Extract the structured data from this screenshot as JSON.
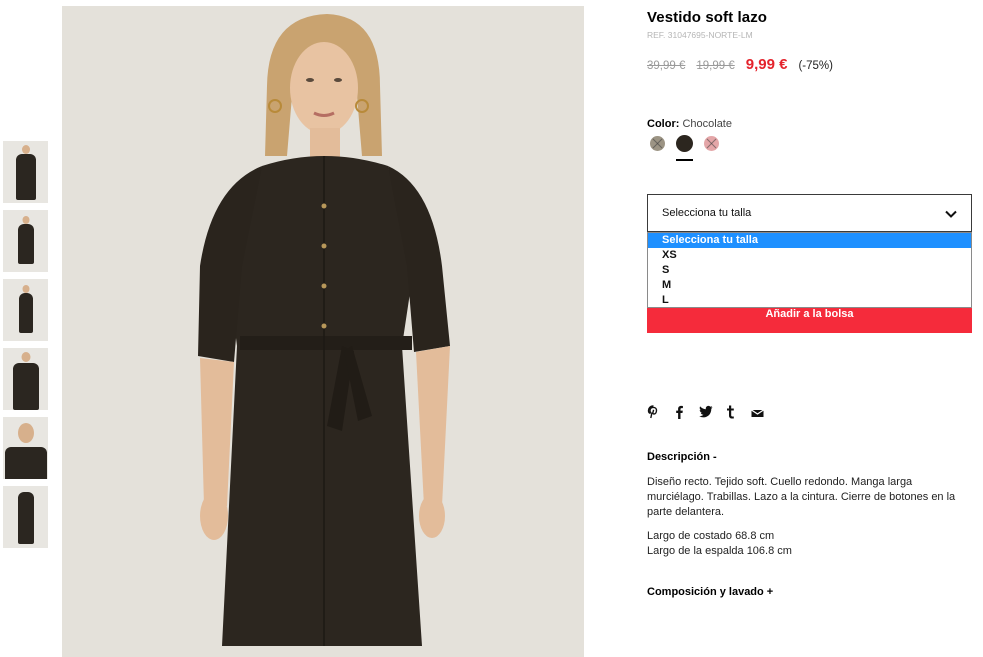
{
  "product": {
    "title": "Vestido soft lazo",
    "ref": "REF. 31047695-NORTE-LM",
    "price_original": "39,99 €",
    "price_previous": "19,99 €",
    "price_current": "9,99 €",
    "discount": "(-75%)"
  },
  "color": {
    "label": "Color:",
    "value": "Chocolate",
    "swatches": [
      {
        "name": "taupe",
        "hex": "#9c9484",
        "available": false
      },
      {
        "name": "chocolate",
        "hex": "#2c261f",
        "available": true
      },
      {
        "name": "pink",
        "hex": "#e4a6a8",
        "available": false
      }
    ]
  },
  "size": {
    "select_label": "Selecciona tu talla",
    "options": [
      "Selecciona tu talla",
      "XS",
      "S",
      "M",
      "L"
    ]
  },
  "add_button": "Añadir a la bolsa",
  "share_icons": [
    "pinterest-icon",
    "facebook-icon",
    "twitter-icon",
    "tumblr-icon",
    "email-icon"
  ],
  "description": {
    "heading": "Descripción -",
    "text": "Diseño recto. Tejido soft. Cuello redondo. Manga larga murciélago. Trabillas. Lazo a la cintura. Cierre de botones en la parte delantera.",
    "measure1": "Largo de costado 68.8 cm",
    "measure2": "Largo de la espalda 106.8 cm"
  },
  "composition_heading": "Composición y lavado +",
  "colors": {
    "accent_red": "#e4232c",
    "button_red": "#f52b3b",
    "selected_option_blue": "#1e90ff"
  }
}
